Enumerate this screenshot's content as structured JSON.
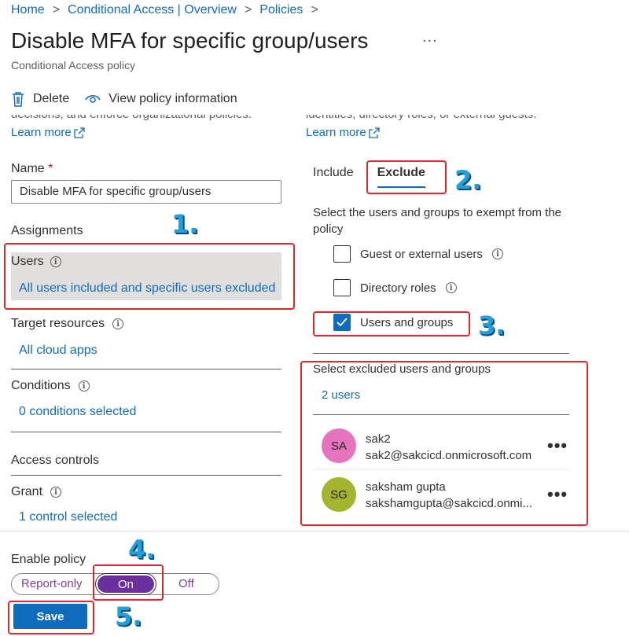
{
  "breadcrumb": [
    "Home",
    "Conditional Access | Overview",
    "Policies"
  ],
  "page": {
    "title": "Disable MFA for specific group/users",
    "more_label": "...",
    "subtitle": "Conditional Access policy"
  },
  "toolbar": {
    "delete_label": "Delete",
    "view_info_label": "View policy information"
  },
  "left": {
    "cut_text": "decisions, and enforce organizational policies.",
    "learn_more": "Learn more",
    "name_label": "Name",
    "required_mark": "*",
    "name_value": "Disable MFA for specific group/users",
    "assignments_heading": "Assignments",
    "users_label": "Users",
    "users_value": "All users included and specific users excluded",
    "target_label": "Target resources",
    "target_value": "All cloud apps",
    "conditions_label": "Conditions",
    "conditions_value": "0 conditions selected",
    "access_heading": "Access controls",
    "grant_label": "Grant",
    "grant_value": "1 control selected"
  },
  "right": {
    "cut_text": "identities, directory roles, or external guests.",
    "learn_more": "Learn more",
    "tab_include": "Include",
    "tab_exclude": "Exclude",
    "description": "Select the users and groups to exempt from the policy",
    "checkboxes": [
      {
        "label": "Guest or external users",
        "checked": false
      },
      {
        "label": "Directory roles",
        "checked": false
      },
      {
        "label": "Users and groups",
        "checked": true
      }
    ],
    "select_excluded_label": "Select excluded users and groups",
    "users_count": "2 users",
    "users": [
      {
        "initials": "SA",
        "name": "sak2",
        "email": "sak2@sakcicd.onmicrosoft.com",
        "avatar_color": "#e573bd"
      },
      {
        "initials": "SG",
        "name": "saksham gupta",
        "email": "sakshamgupta@sakcicd.onmi...",
        "avatar_color": "#a4b42e"
      }
    ],
    "row_more": "•••"
  },
  "enable_policy": {
    "label": "Enable policy",
    "options": [
      "Report-only",
      "On",
      "Off"
    ],
    "selected": "On"
  },
  "save_label": "Save",
  "step_markers": [
    "1.",
    "2.",
    "3.",
    "4.",
    "5."
  ],
  "colors": {
    "accent": "#0f6cbd",
    "toggle_on": "#6b2fa0",
    "annotation_box": "#e0262f",
    "annotation_number": "#22a0dc"
  }
}
